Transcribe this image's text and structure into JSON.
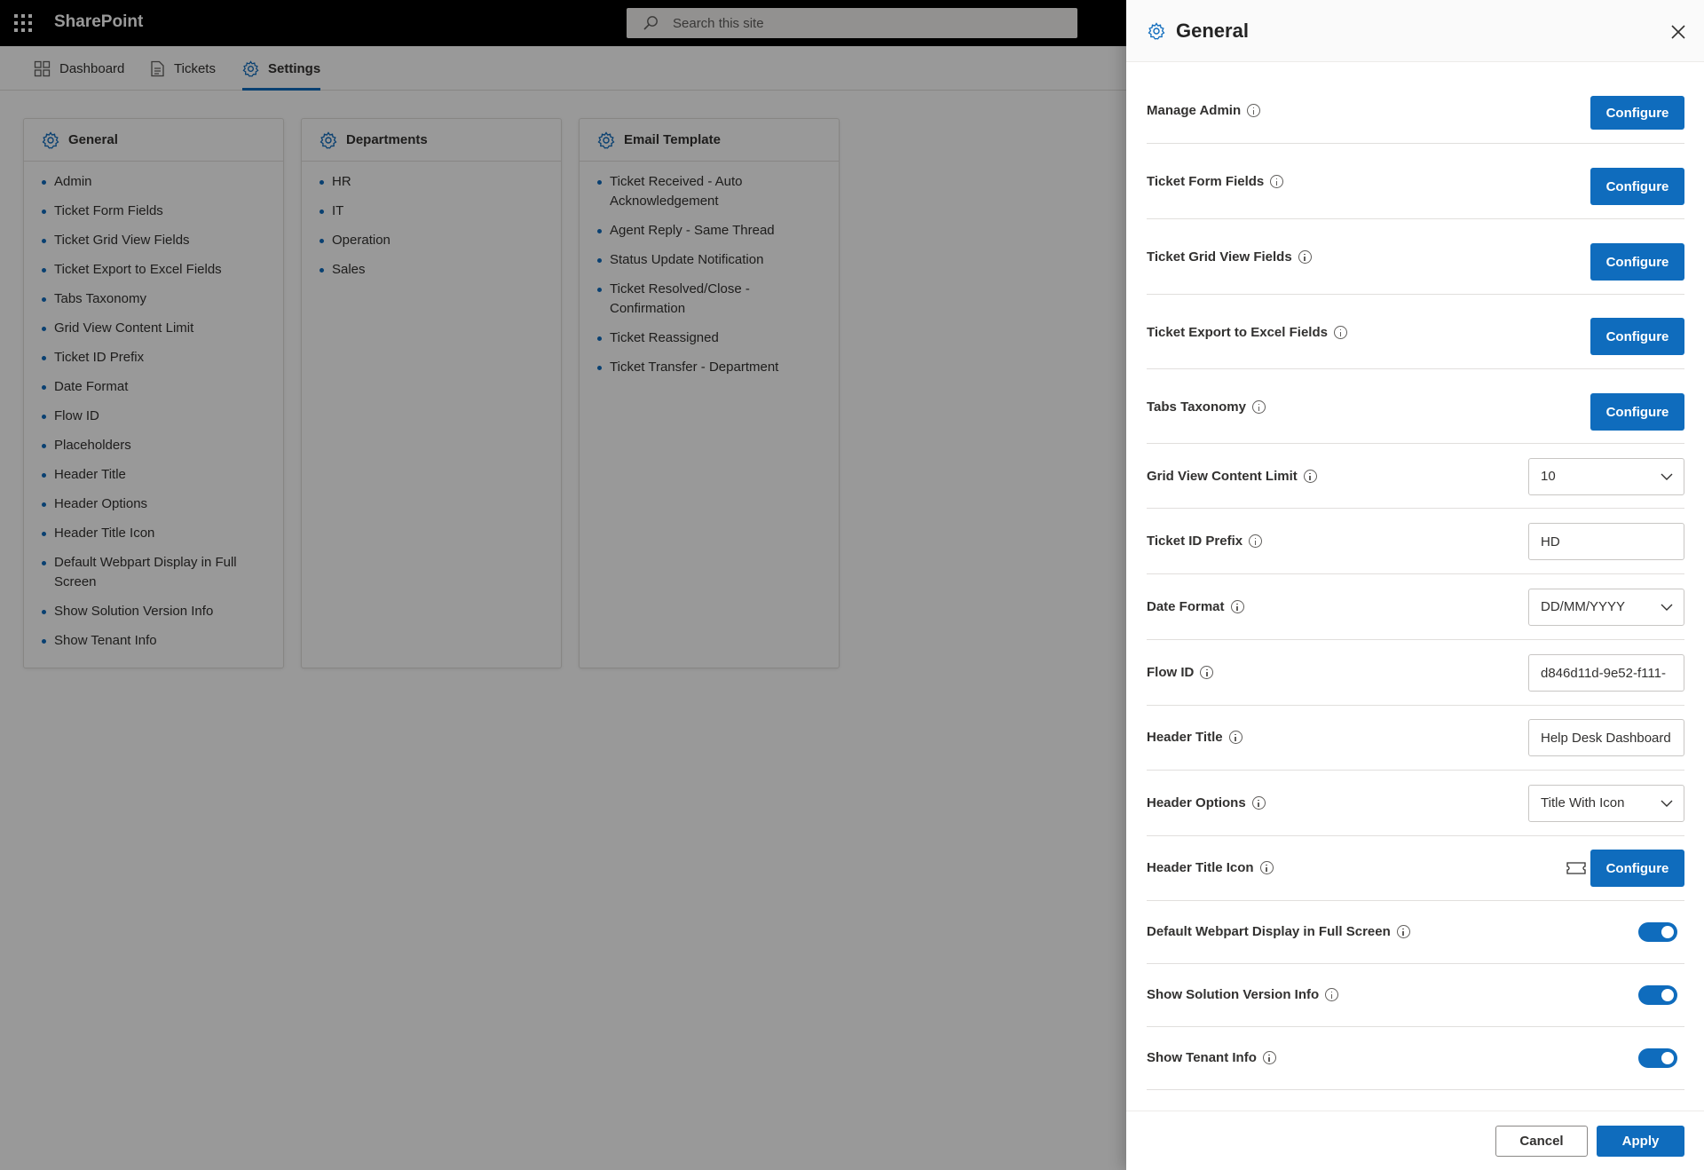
{
  "app": {
    "brand": "SharePoint",
    "search_placeholder": "Search this site"
  },
  "nav": {
    "dashboard": "Dashboard",
    "tickets": "Tickets",
    "settings": "Settings"
  },
  "cards": {
    "general": {
      "title": "General",
      "items": [
        "Admin",
        "Ticket Form Fields",
        "Ticket Grid View Fields",
        "Ticket Export to Excel Fields",
        "Tabs Taxonomy",
        "Grid View Content Limit",
        "Ticket ID Prefix",
        "Date Format",
        "Flow ID",
        "Placeholders",
        "Header Title",
        "Header Options",
        "Header Title Icon",
        "Default Webpart Display in Full Screen",
        "Show Solution Version Info",
        "Show Tenant Info"
      ]
    },
    "departments": {
      "title": "Departments",
      "items": [
        "HR",
        "IT",
        "Operation",
        "Sales"
      ]
    },
    "email": {
      "title": "Email Template",
      "items": [
        "Ticket Received - Auto Acknowledgement",
        "Agent Reply - Same Thread",
        "Status Update Notification",
        "Ticket Resolved/Close - Confirmation",
        "Ticket Reassigned",
        "Ticket Transfer - Department"
      ]
    }
  },
  "panel": {
    "title": "General",
    "configure_label": "Configure",
    "rows": {
      "manage_admin": "Manage Admin",
      "ticket_form_fields": "Ticket Form Fields",
      "ticket_grid_view_fields": "Ticket Grid View Fields",
      "ticket_export_excel": "Ticket Export to Excel Fields",
      "tabs_taxonomy": "Tabs Taxonomy",
      "grid_view_limit": "Grid View Content Limit",
      "ticket_id_prefix": "Ticket ID Prefix",
      "date_format": "Date Format",
      "flow_id": "Flow ID",
      "header_title": "Header Title",
      "header_options": "Header Options",
      "header_title_icon": "Header Title Icon",
      "default_fullscreen": "Default Webpart Display in Full Screen",
      "show_version": "Show Solution Version Info",
      "show_tenant": "Show Tenant Info"
    },
    "values": {
      "grid_view_limit": "10",
      "ticket_id_prefix": "HD",
      "date_format": "DD/MM/YYYY",
      "flow_id": "d846d11d-9e52-f111-",
      "header_title": "Help Desk Dashboard",
      "header_options": "Title With Icon"
    },
    "toggles": {
      "default_fullscreen": true,
      "show_version": true,
      "show_tenant": true
    },
    "cancel_label": "Cancel",
    "apply_label": "Apply"
  },
  "colors": {
    "accent": "#0f6cbd",
    "suitebar": "#000000"
  }
}
